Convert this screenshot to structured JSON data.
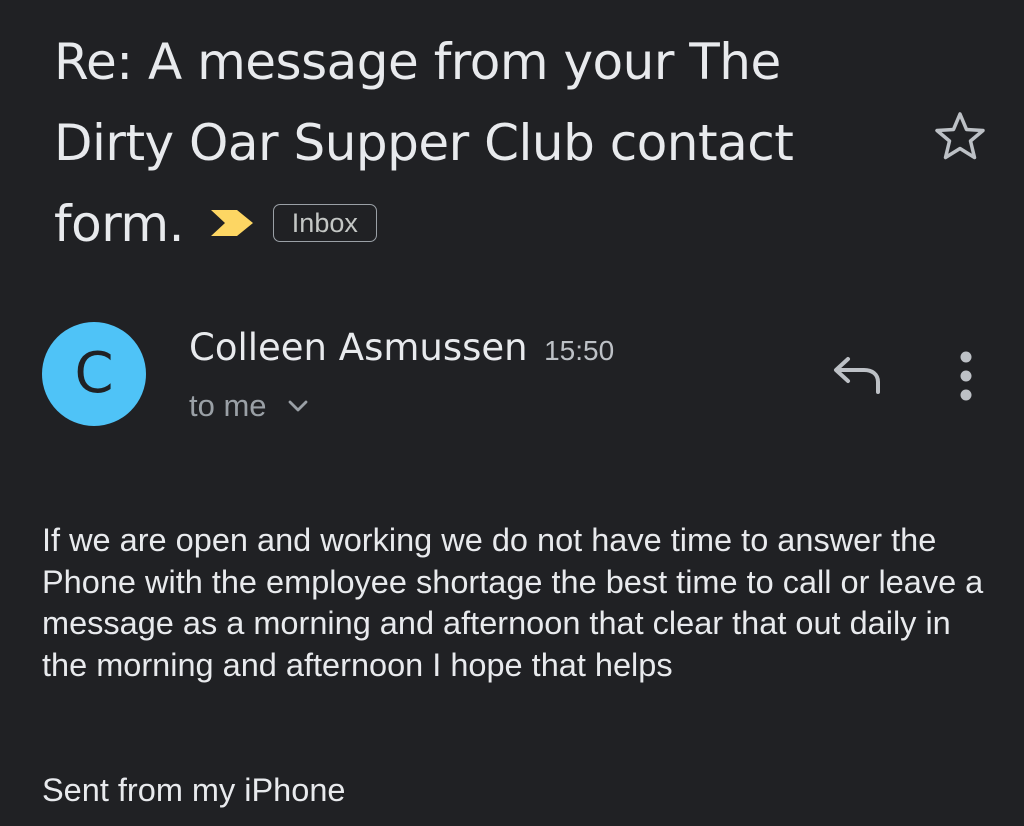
{
  "email": {
    "subject": "Re: A message from your The Dirty Oar Supper Club contact form.",
    "label": "Inbox",
    "importance_icon": "important-marker-icon",
    "star_icon": "star-outline-icon",
    "sender": {
      "avatar_letter": "C",
      "avatar_color": "#4fc3f7",
      "name": "Colleen Asmussen",
      "time": "15:50",
      "recipient_label": "to me"
    },
    "actions": {
      "reply_icon": "reply-icon",
      "more_icon": "more-vert-icon"
    },
    "body_text": "If we are open and working we do not have time to answer the Phone with the employee shortage the best time to call or leave a message as a morning and afternoon that clear that out daily in the morning and afternoon I hope that helps",
    "signature": "Sent from my iPhone"
  },
  "colors": {
    "background": "#202124",
    "text_primary": "#e8eaed",
    "text_secondary": "#9aa0a6",
    "importance": "#fdd663",
    "avatar": "#4fc3f7"
  }
}
